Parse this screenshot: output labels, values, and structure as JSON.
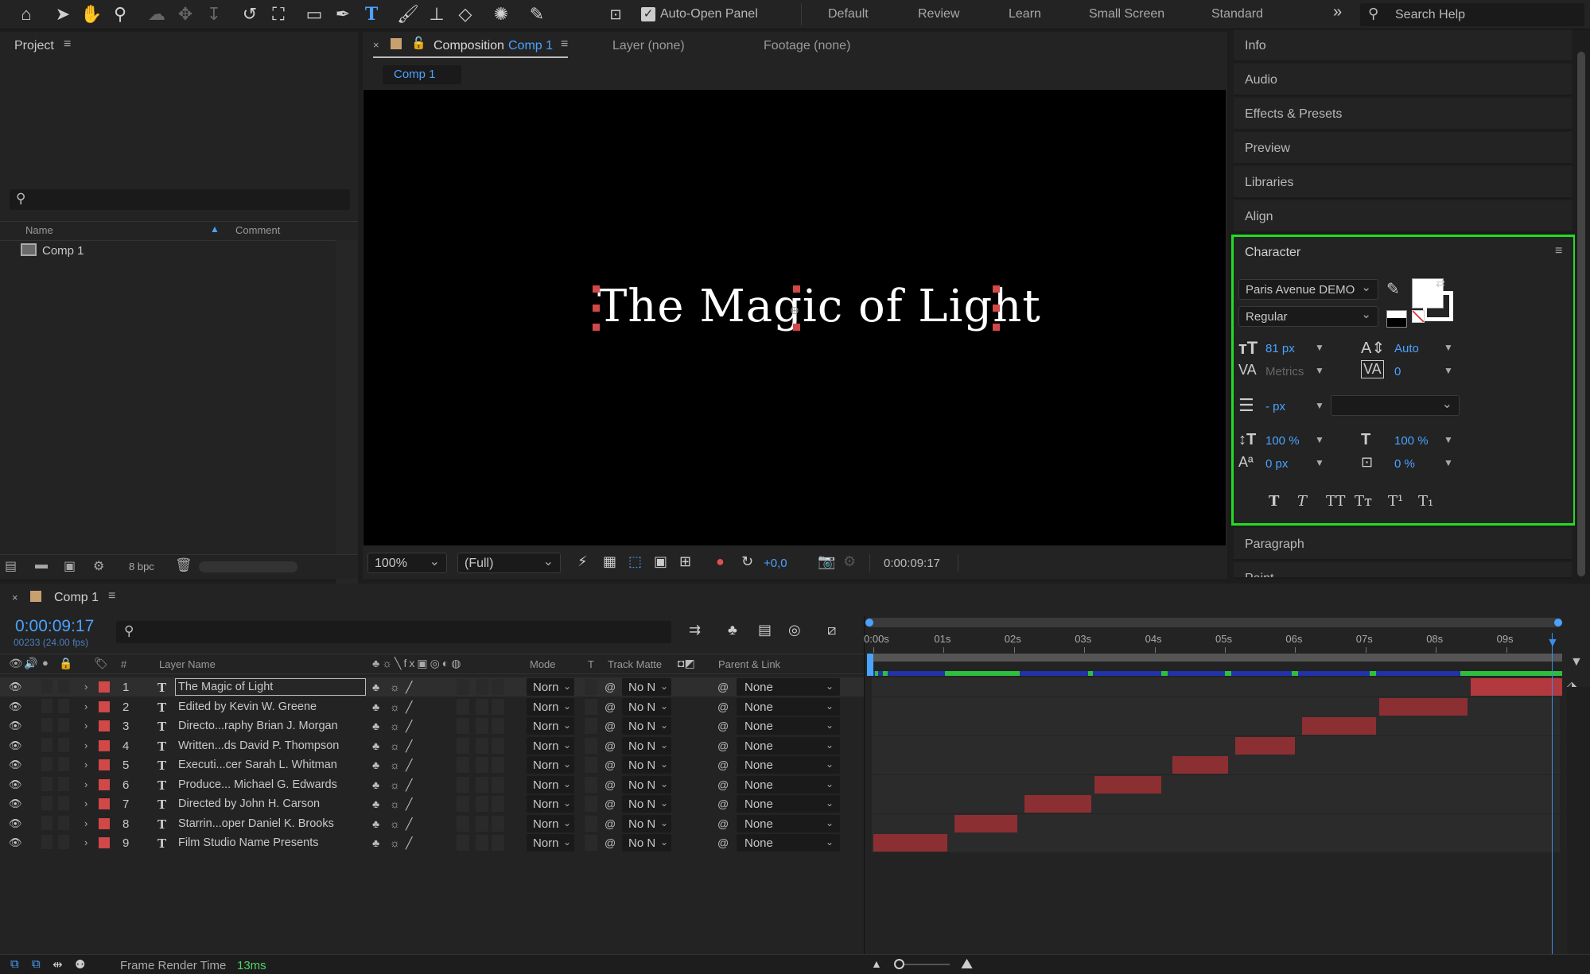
{
  "toolbar": {
    "auto_open_label": "Auto-Open Panel",
    "workspaces": [
      "Default",
      "Review",
      "Learn",
      "Small Screen",
      "Standard"
    ],
    "more": "»",
    "search_placeholder": "Search Help"
  },
  "project": {
    "title": "Project",
    "menu": "≡",
    "col_name": "Name",
    "col_comment": "Comment",
    "items": [
      {
        "label": "Comp 1"
      }
    ],
    "bpc": "8 bpc"
  },
  "composition": {
    "tab_prefix": "Composition",
    "tab_comp": "Comp 1",
    "layer_tab": "Layer (none)",
    "footage_tab": "Footage (none)",
    "subtab": "Comp 1",
    "viewer_text": "The Magic of Light",
    "zoom": "100%",
    "resolution": "(Full)",
    "exposure": "+0,0",
    "timecode": "0:00:09:17"
  },
  "right_panels": {
    "top": [
      "Info",
      "Audio",
      "Effects & Presets",
      "Preview",
      "Libraries",
      "Align"
    ],
    "bottom": [
      "Paragraph",
      "Paint"
    ]
  },
  "character": {
    "title": "Character",
    "font": "Paris Avenue DEMO",
    "style": "Regular",
    "size": "81 px",
    "leading": "Auto",
    "kerning": "Metrics",
    "tracking": "0",
    "stroke_width": "- px",
    "v_scale": "100 %",
    "h_scale": "100 %",
    "baseline": "0 px",
    "tsume": "0 %",
    "fill_color": "#ffffff",
    "highlight_color": "#22dd22"
  },
  "timeline": {
    "comp_tab": "Comp 1",
    "timecode": "0:00:09:17",
    "frame_info": "00233 (24.00 fps)",
    "col_layer_name": "Layer Name",
    "col_mode": "Mode",
    "col_t": "T",
    "col_track_matte": "Track Matte",
    "col_parent": "Parent & Link",
    "ticks": [
      "0:00s",
      "01s",
      "02s",
      "03s",
      "04s",
      "05s",
      "06s",
      "07s",
      "08s",
      "09s"
    ],
    "layers": [
      {
        "num": "1",
        "name": "The Magic of Light",
        "mode": "Norn",
        "matte": "No N",
        "parent": "None",
        "start": 8.5,
        "end": 9.8
      },
      {
        "num": "2",
        "name": "Edited by  Kevin W. Greene",
        "mode": "Norn",
        "matte": "No N",
        "parent": "None",
        "start": 7.2,
        "end": 8.45
      },
      {
        "num": "3",
        "name": "Directo...raphy  Brian J. Morgan",
        "mode": "Norn",
        "matte": "No N",
        "parent": "None",
        "start": 6.1,
        "end": 7.15
      },
      {
        "num": "4",
        "name": "Written...ds David P. Thompson",
        "mode": "Norn",
        "matte": "No N",
        "parent": "None",
        "start": 5.15,
        "end": 6.0
      },
      {
        "num": "5",
        "name": "Executi...cer  Sarah L. Whitman",
        "mode": "Norn",
        "matte": "No N",
        "parent": "None",
        "start": 4.25,
        "end": 5.05
      },
      {
        "num": "6",
        "name": "Produce...  Michael G. Edwards",
        "mode": "Norn",
        "matte": "No N",
        "parent": "None",
        "start": 3.15,
        "end": 4.1
      },
      {
        "num": "7",
        "name": "Directed by  John H. Carson",
        "mode": "Norn",
        "matte": "No N",
        "parent": "None",
        "start": 2.15,
        "end": 3.1
      },
      {
        "num": "8",
        "name": "Starrin...oper Daniel K. Brooks",
        "mode": "Norn",
        "matte": "No N",
        "parent": "None",
        "start": 1.15,
        "end": 2.05
      },
      {
        "num": "9",
        "name": "Film Studio Name Presents",
        "mode": "Norn",
        "matte": "No N",
        "parent": "None",
        "start": 0.0,
        "end": 1.05
      }
    ]
  },
  "status": {
    "label": "Frame Render Time",
    "value": "13ms"
  }
}
